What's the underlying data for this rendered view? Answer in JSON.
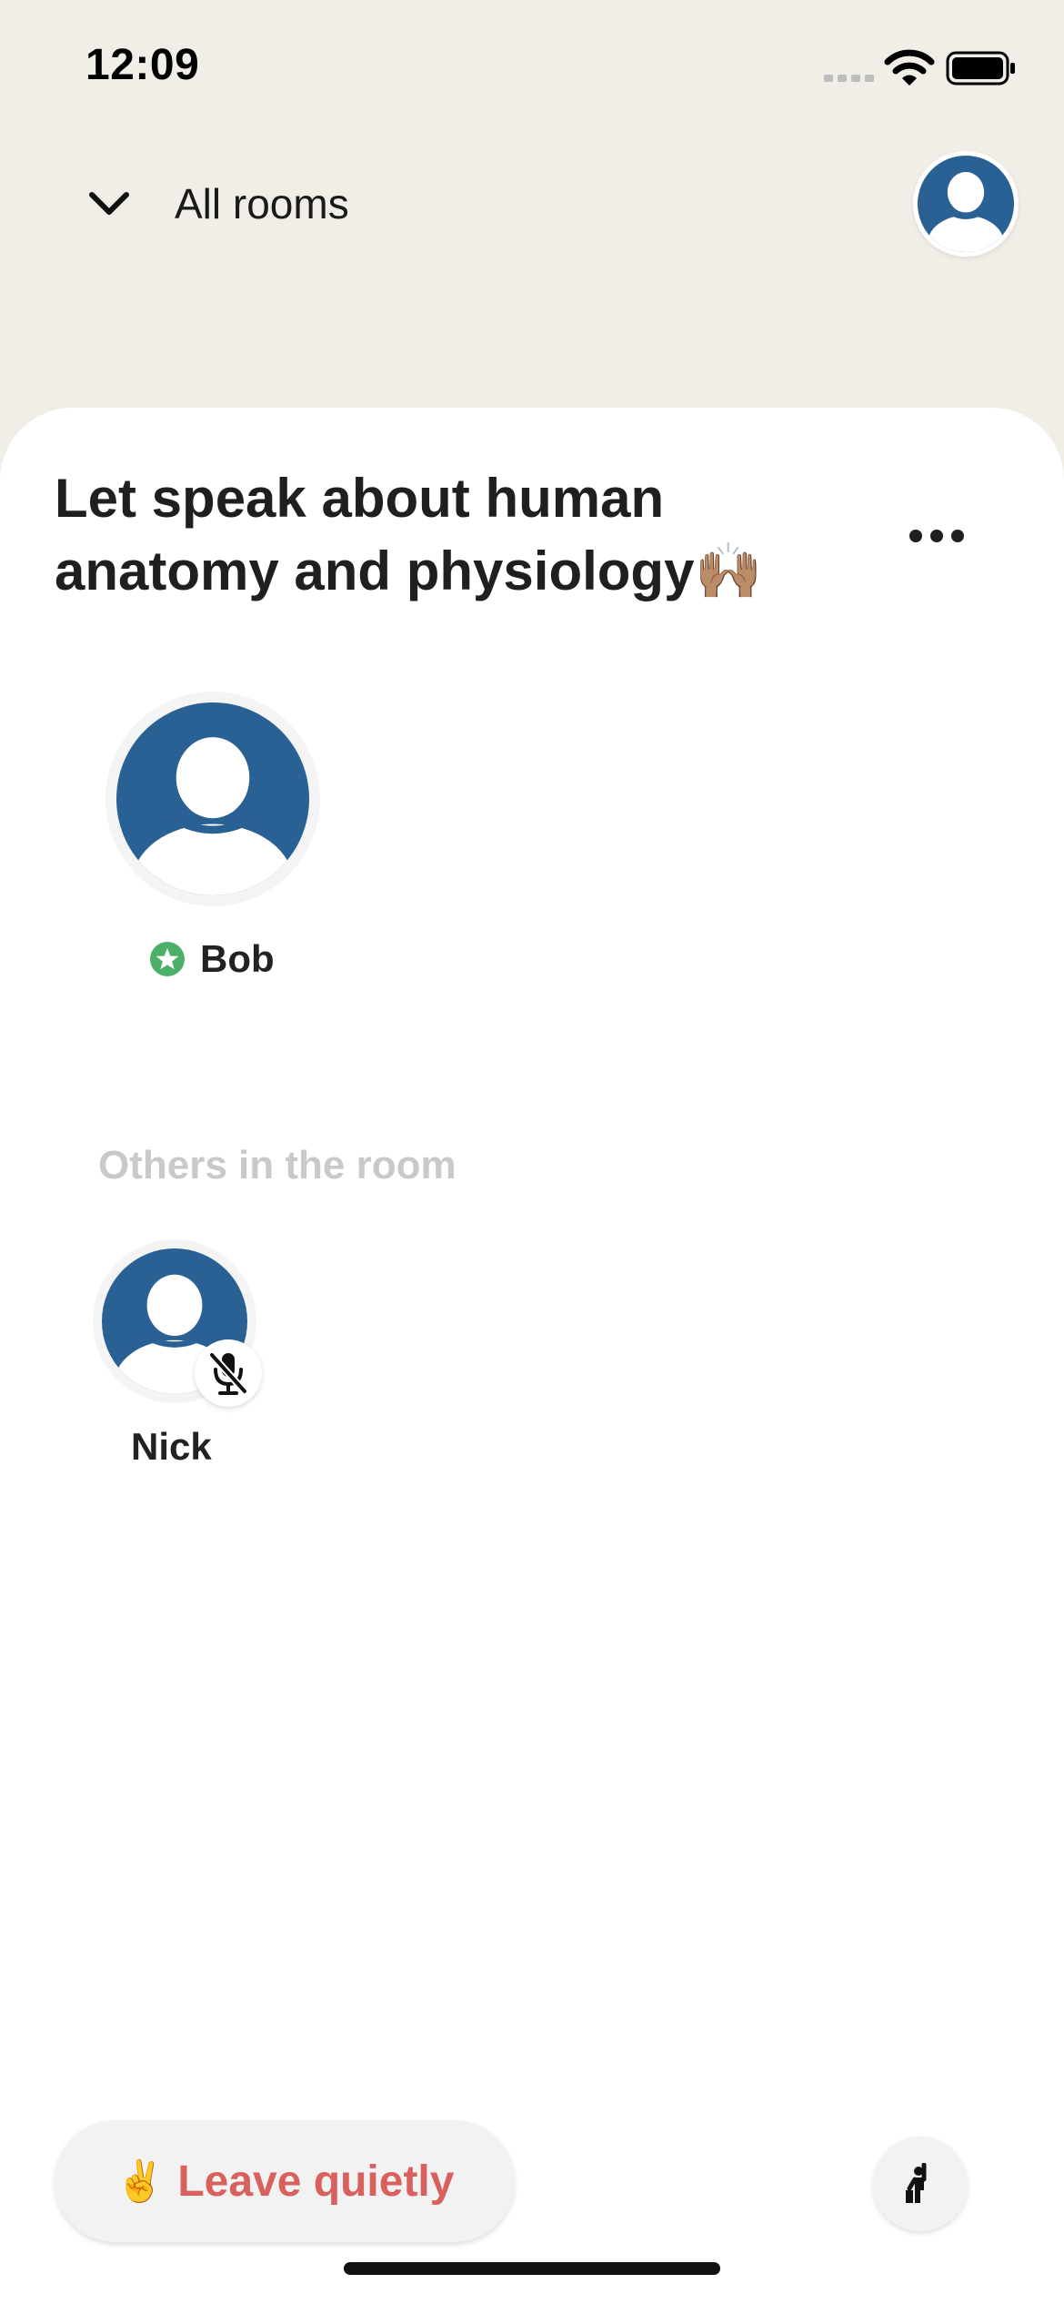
{
  "status_bar": {
    "time": "12:09",
    "icons": [
      "signal-icon",
      "wifi-icon",
      "battery-icon"
    ]
  },
  "nav": {
    "back_icon": "chevron-down-icon",
    "back_label": "All rooms",
    "profile_icon": "user-avatar-icon"
  },
  "room": {
    "title": "Let speak about human anatomy and physiology🙌🏽",
    "more_icon": "more-dots-icon"
  },
  "speakers": [
    {
      "name": "Bob",
      "badge_icon": "moderator-star-icon"
    }
  ],
  "others": {
    "heading": "Others in the room",
    "listeners": [
      {
        "name": "Nick",
        "badge_icon": "mic-muted-icon"
      }
    ]
  },
  "bottom_bar": {
    "leave_emoji": "✌️",
    "leave_label": "Leave quietly",
    "raise_hand_icon": "raise-hand-icon"
  },
  "colors": {
    "background": "#f1eee7",
    "sheet": "#ffffff",
    "avatar": "#2a6194",
    "leave_text": "#d8615d",
    "moderator_badge": "#4caf6a",
    "muted_heading": "#c9c9c9"
  }
}
